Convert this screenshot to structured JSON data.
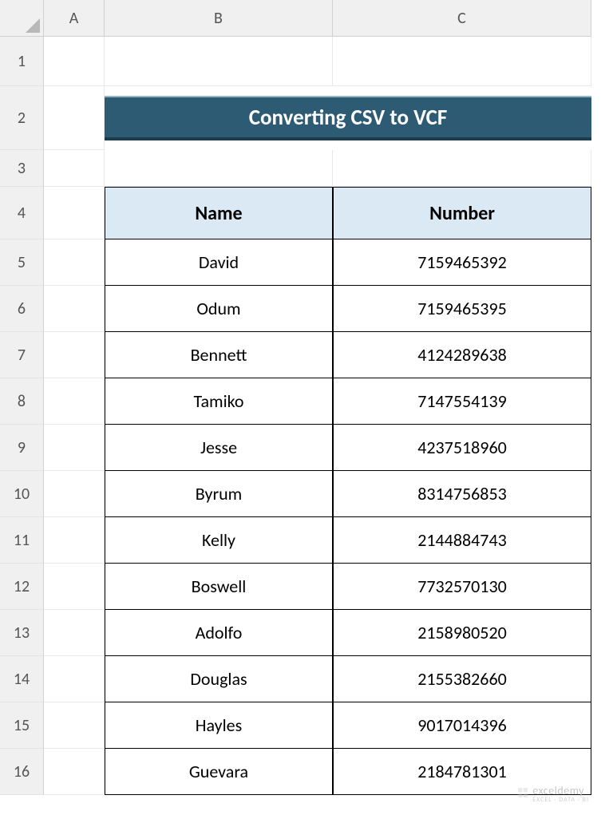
{
  "columns": [
    "A",
    "B",
    "C"
  ],
  "rows": [
    "1",
    "2",
    "3",
    "4",
    "5",
    "6",
    "7",
    "8",
    "9",
    "10",
    "11",
    "12",
    "13",
    "14",
    "15",
    "16"
  ],
  "title": "Converting CSV to VCF",
  "headers": {
    "name": "Name",
    "number": "Number"
  },
  "table": [
    {
      "name": "David",
      "number": "7159465392"
    },
    {
      "name": "Odum",
      "number": "7159465395"
    },
    {
      "name": "Bennett",
      "number": "4124289638"
    },
    {
      "name": "Tamiko",
      "number": "7147554139"
    },
    {
      "name": "Jesse",
      "number": "4237518960"
    },
    {
      "name": "Byrum",
      "number": "8314756853"
    },
    {
      "name": "Kelly",
      "number": "2144884743"
    },
    {
      "name": "Boswell",
      "number": "7732570130"
    },
    {
      "name": "Adolfo",
      "number": "2158980520"
    },
    {
      "name": "Douglas",
      "number": "2155382660"
    },
    {
      "name": "Hayles",
      "number": "9017014396"
    },
    {
      "name": "Guevara",
      "number": "2184781301"
    }
  ],
  "watermark": {
    "brand": "exceldemy",
    "tagline": "EXCEL · DATA · BI"
  }
}
